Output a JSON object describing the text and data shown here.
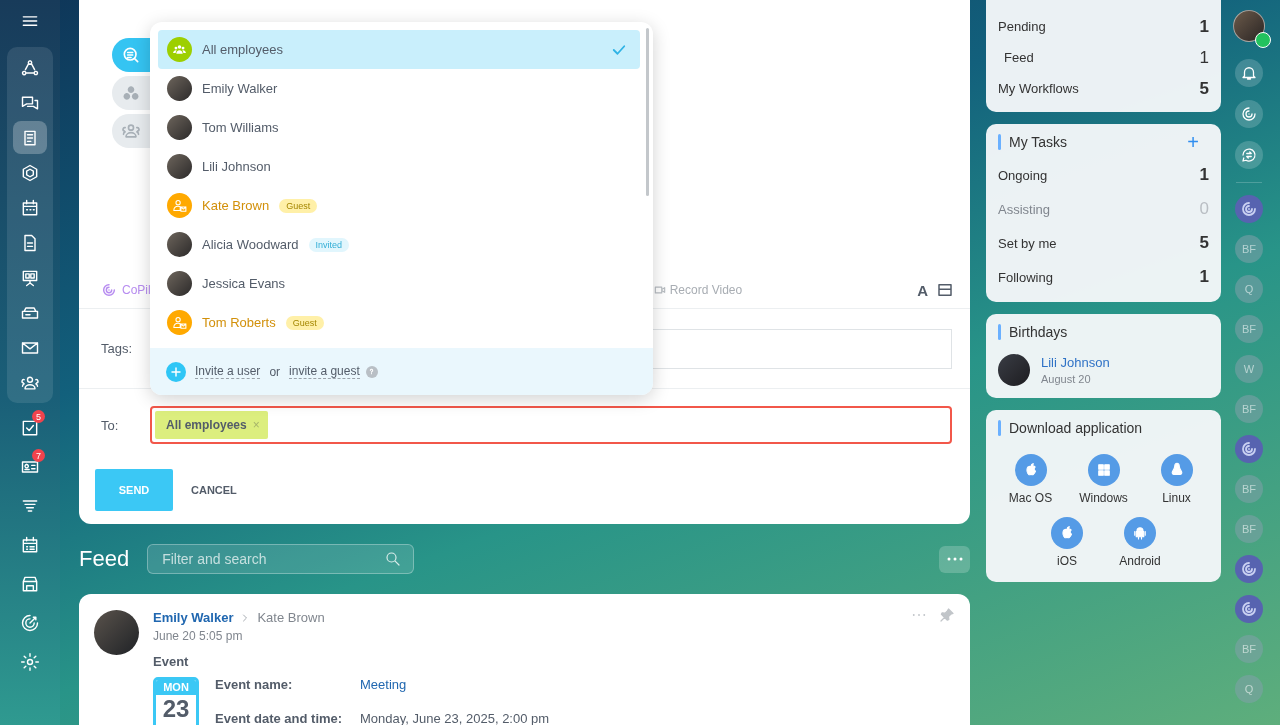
{
  "sidebar": {
    "pinned_items": [
      {
        "kind": "nodes",
        "selected": false
      },
      {
        "kind": "chat",
        "selected": false
      },
      {
        "kind": "news",
        "selected": true
      },
      {
        "kind": "hexagon",
        "selected": false
      },
      {
        "kind": "calendar",
        "selected": false
      },
      {
        "kind": "document",
        "selected": false
      },
      {
        "kind": "presentation",
        "selected": false
      },
      {
        "kind": "drive",
        "selected": false
      },
      {
        "kind": "mail",
        "selected": false
      },
      {
        "kind": "people",
        "selected": false
      }
    ],
    "items": [
      {
        "kind": "checkbox",
        "badge": "5"
      },
      {
        "kind": "idcard",
        "badge": "7"
      },
      {
        "kind": "funnel"
      },
      {
        "kind": "schedule"
      },
      {
        "kind": "shop"
      },
      {
        "kind": "target"
      },
      {
        "kind": "settings"
      }
    ]
  },
  "composer": {
    "tabs": [
      {
        "kind": "message",
        "selected": true
      },
      {
        "kind": "groups",
        "selected": false
      },
      {
        "kind": "people",
        "selected": false
      }
    ],
    "toolbar": {
      "copilot": "CoPil",
      "record_video": "Record Video",
      "text_format": "A"
    },
    "tags": {
      "label": "Tags:"
    },
    "recipients": {
      "label": "To:",
      "error": true,
      "chips": [
        {
          "text": "All employees",
          "remove": "×"
        }
      ]
    },
    "buttons": {
      "send": "SEND",
      "cancel": "CANCEL"
    },
    "dropdown": {
      "items": [
        {
          "name": "All employees",
          "kind": "group",
          "selected": true
        },
        {
          "name": "Emily Walker",
          "kind": "user",
          "selected": false
        },
        {
          "name": "Tom Williams",
          "kind": "user",
          "selected": false
        },
        {
          "name": "Lili Johnson",
          "kind": "user",
          "selected": false
        },
        {
          "name": "Kate Brown",
          "kind": "guest",
          "badge": "Guest",
          "selected": false
        },
        {
          "name": "Alicia Woodward",
          "kind": "user",
          "badge": "Invited",
          "selected": false
        },
        {
          "name": "Jessica Evans",
          "kind": "user",
          "selected": false
        },
        {
          "name": "Tom Roberts",
          "kind": "guest",
          "badge": "Guest",
          "selected": false
        }
      ],
      "footer": {
        "invite_user": "Invite a user",
        "or": "or",
        "invite_guest": "invite a guest"
      }
    }
  },
  "feed": {
    "title": "Feed",
    "search": {
      "placeholder": "Filter and search"
    },
    "post": {
      "author": "Emily Walker",
      "recipient": "Kate Brown",
      "time": "June 20 5:05 pm",
      "type": "Event",
      "calendar": {
        "weekday": "MON",
        "day": "23"
      },
      "fields": [
        {
          "label": "Event name:",
          "value": "Meeting",
          "link": true
        },
        {
          "label": "Event date and time:",
          "value": "Monday, June 23, 2025, 2:00 pm",
          "link": false
        }
      ]
    }
  },
  "counters": {
    "rows": [
      {
        "label": "Pending",
        "count": "1",
        "children": [
          {
            "label": "Feed",
            "count": "1"
          }
        ]
      },
      {
        "label": "My Workflows",
        "count": "5",
        "children": []
      }
    ]
  },
  "tasks": {
    "title": "My Tasks",
    "add": "+",
    "rows": [
      {
        "label": "Ongoing",
        "count": "1",
        "muted": false
      },
      {
        "label": "Assisting",
        "count": "0",
        "muted": true
      },
      {
        "label": "Set by me",
        "count": "5",
        "muted": false
      },
      {
        "label": "Following",
        "count": "1",
        "muted": false
      }
    ]
  },
  "birthdays": {
    "title": "Birthdays",
    "people": [
      {
        "name": "Lili Johnson",
        "date": "August 20"
      }
    ]
  },
  "download": {
    "title": "Download application",
    "apps": [
      {
        "name": "Mac OS",
        "kind": "apple"
      },
      {
        "name": "Windows",
        "kind": "windows"
      },
      {
        "name": "Linux",
        "kind": "linux"
      },
      {
        "name": "iOS",
        "kind": "apple"
      },
      {
        "name": "Android",
        "kind": "android"
      }
    ]
  },
  "rail": {
    "items": [
      {
        "kind": "copilot"
      },
      {
        "kind": "initials",
        "text": "BF"
      },
      {
        "kind": "initials",
        "text": "Q"
      },
      {
        "kind": "initials",
        "text": "BF"
      },
      {
        "kind": "initials",
        "text": "W"
      },
      {
        "kind": "initials",
        "text": "BF"
      },
      {
        "kind": "copilot"
      },
      {
        "kind": "initials",
        "text": "BF"
      },
      {
        "kind": "initials",
        "text": "BF"
      },
      {
        "kind": "copilot"
      },
      {
        "kind": "copilot"
      },
      {
        "kind": "initials",
        "text": "BF"
      },
      {
        "kind": "initials",
        "text": "Q"
      }
    ]
  }
}
